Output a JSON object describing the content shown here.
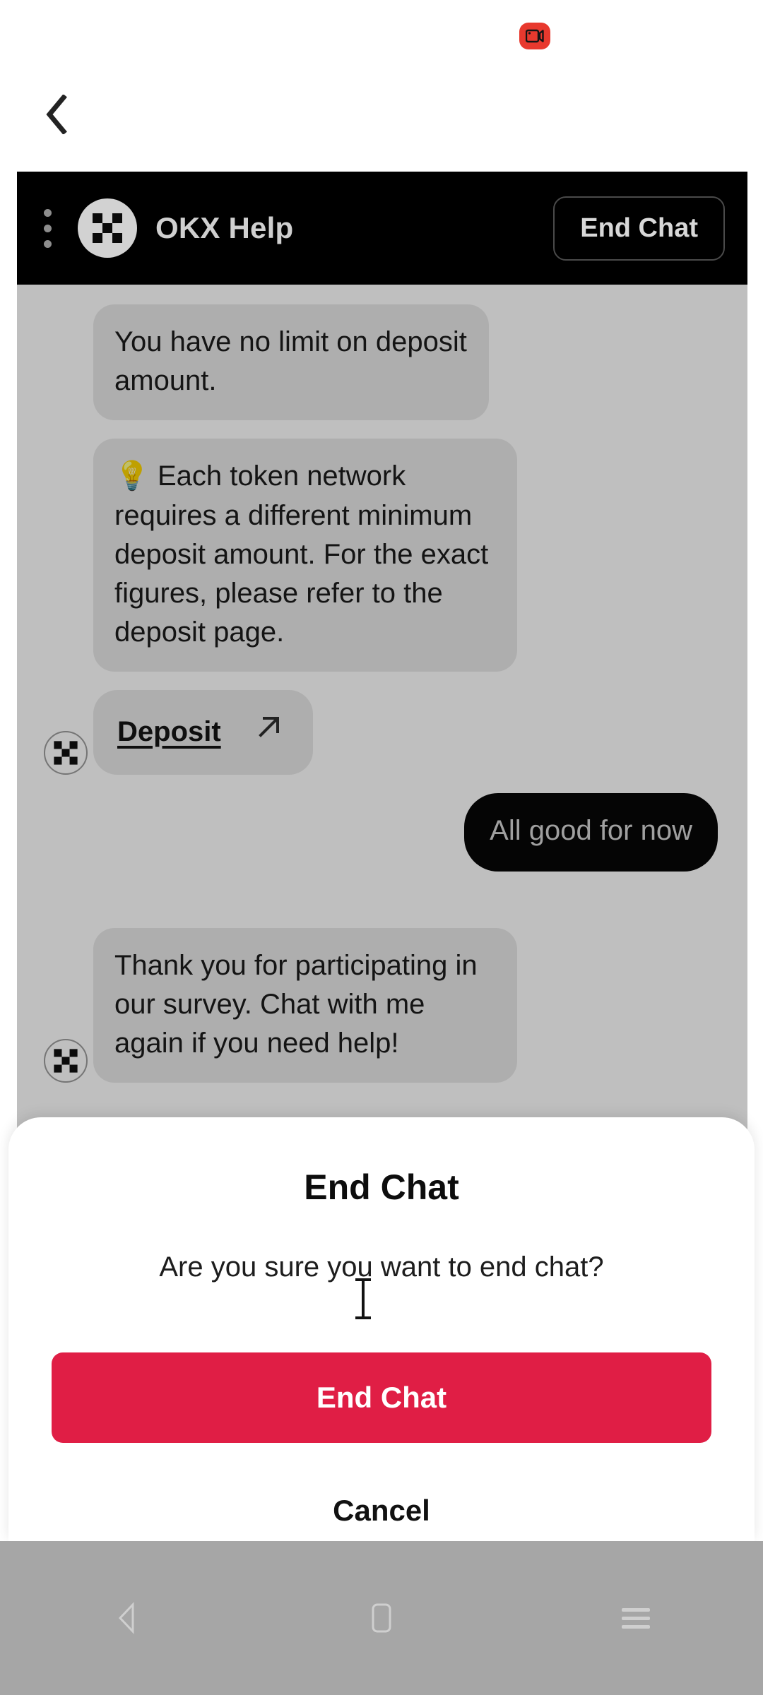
{
  "status": {
    "recording_icon": "video-camera-icon"
  },
  "nav": {
    "back_icon": "chevron-left-icon"
  },
  "chat_header": {
    "menu_icon": "kebab-menu-icon",
    "avatar_icon": "okx-logo-icon",
    "title": "OKX Help",
    "end_chat_label": "End Chat"
  },
  "messages": [
    {
      "sender": "agent",
      "text": "You have no limit on deposit amount."
    },
    {
      "sender": "agent",
      "emoji": "💡",
      "text": "Each token network requires a different minimum deposit amount. For the exact figures, please refer to the deposit page."
    },
    {
      "sender": "agent",
      "type": "link",
      "text": "Deposit",
      "link_icon": "arrow-up-right-icon",
      "avatar_icon": "okx-logo-icon"
    },
    {
      "sender": "user",
      "text": "All good for now"
    },
    {
      "sender": "agent",
      "text": "Thank you for participating in our survey. Chat with me again if you need help!",
      "avatar_icon": "okx-logo-icon"
    }
  ],
  "modal": {
    "title": "End Chat",
    "subtitle": "Are you sure you want to end chat?",
    "confirm_label": "End Chat",
    "cancel_label": "Cancel",
    "confirm_color": "#E01E45"
  },
  "system_nav": {
    "back_icon": "triangle-back-icon",
    "home_icon": "square-home-icon",
    "recents_icon": "lines-recents-icon"
  }
}
